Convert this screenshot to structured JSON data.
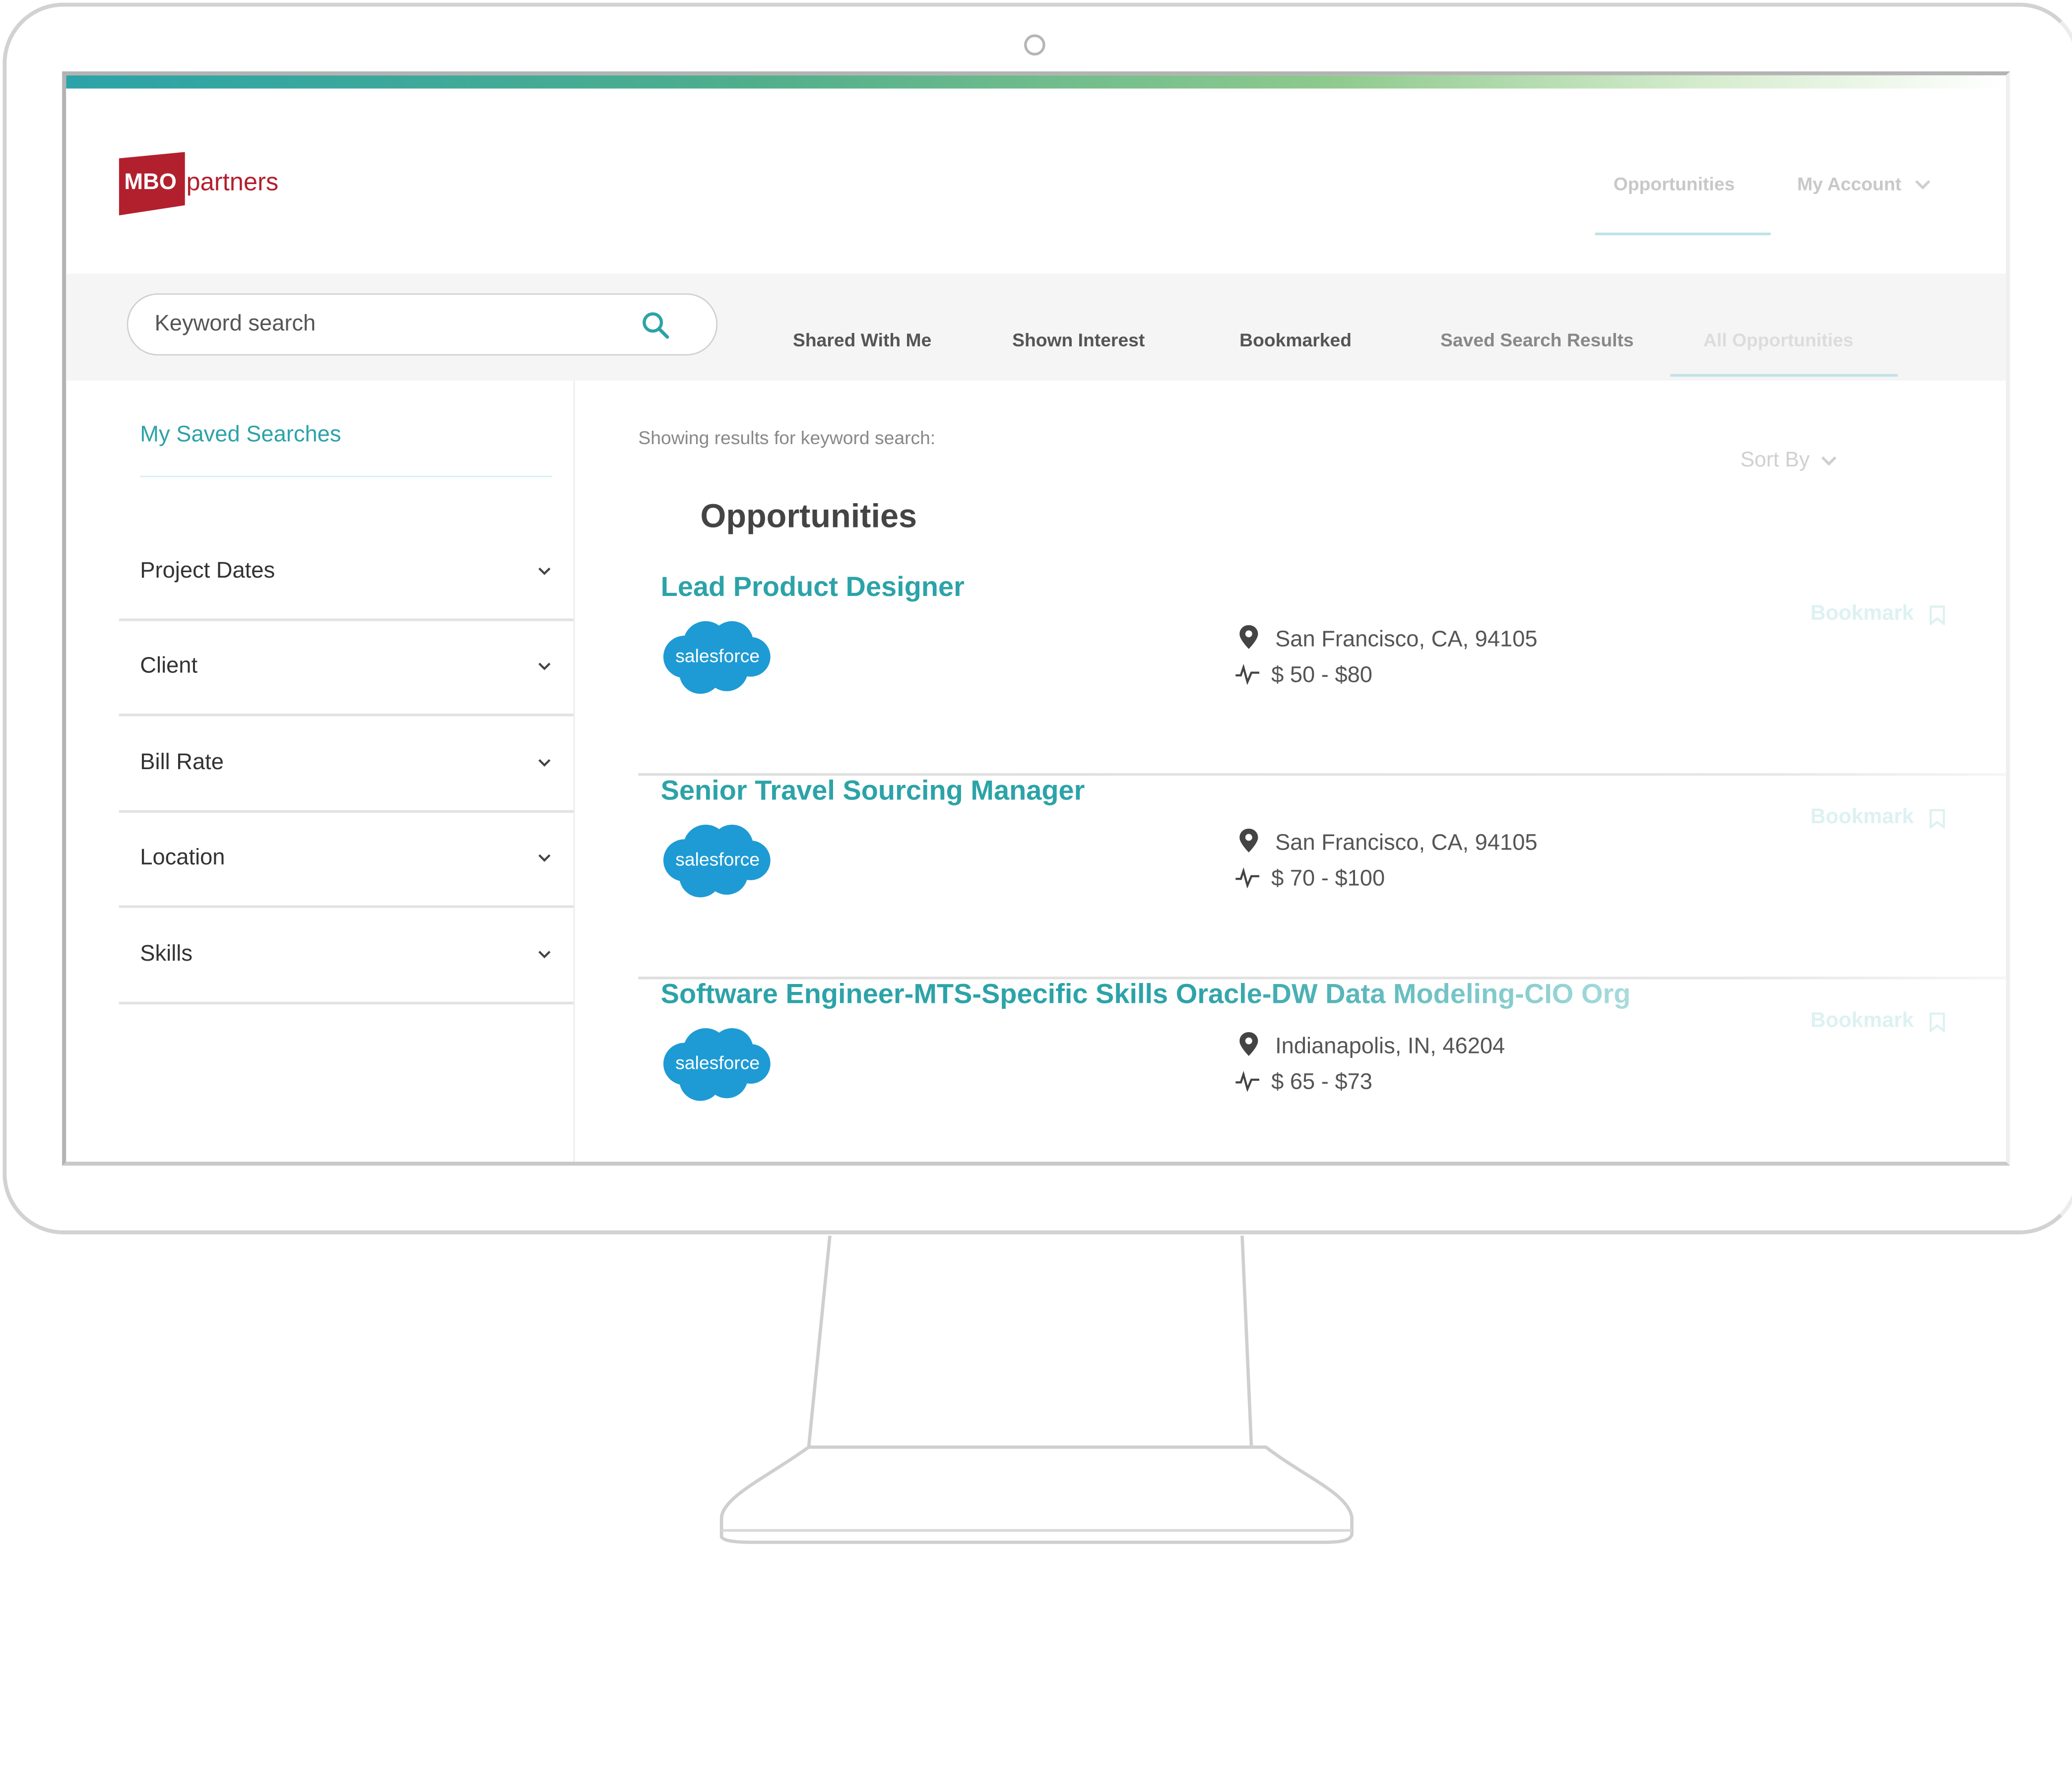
{
  "brand": {
    "mbo": "MBO",
    "partners": "partners",
    "red": "#b2202e",
    "teal": "#2ca3a8"
  },
  "topnav": {
    "opportunities": "Opportunities",
    "my_account": "My Account"
  },
  "search": {
    "placeholder": "Keyword search"
  },
  "tabs": [
    "Shared With Me",
    "Shown Interest",
    "Bookmarked",
    "Saved Search Results",
    "All Opportunities"
  ],
  "sidebar": {
    "saved_searches": "My Saved Searches",
    "filters": [
      "Project Dates",
      "Client",
      "Bill Rate",
      "Location",
      "Skills"
    ]
  },
  "results": {
    "label": "Showing results for keyword search:",
    "sort_by": "Sort By",
    "heading": "Opportunities",
    "bookmark_label": "Bookmark",
    "jobs": [
      {
        "title": "Lead Product Designer",
        "client": "salesforce",
        "location": "San Francisco, CA, 94105",
        "rate": "$ 50 - $80"
      },
      {
        "title": "Senior Travel Sourcing Manager",
        "client": "salesforce",
        "location": "San Francisco, CA, 94105",
        "rate": "$ 70 - $100"
      },
      {
        "title": "Software Engineer-MTS-Specific Skills Oracle-DW Data Modeling-CIO Org",
        "client": "salesforce",
        "location": "Indianapolis, IN, 46204",
        "rate": "$ 65 - $73"
      }
    ]
  },
  "icons": [
    "search-icon",
    "chevron-down-icon",
    "location-pin-icon",
    "rate-pulse-icon",
    "bookmark-icon",
    "salesforce-cloud-logo",
    "camera-icon"
  ]
}
